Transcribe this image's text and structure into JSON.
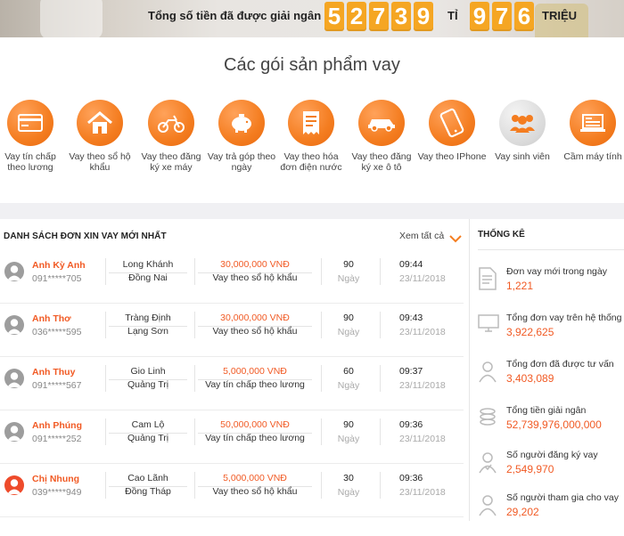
{
  "banner": {
    "label": "Tổng số tiền đã được giải ngân :",
    "billions_digits": [
      "5",
      "2",
      "7",
      "3",
      "9"
    ],
    "billion_unit": "TỈ",
    "millions_digits": [
      "9",
      "7",
      "6"
    ],
    "million_unit": "TRIỆU",
    "digit_color": "#f5a623"
  },
  "products": {
    "title": "Các gói sản phẩm vay",
    "items": [
      {
        "label": "Vay tín chấp theo lương",
        "icon": "credit-card-icon"
      },
      {
        "label": "Vay theo sổ hộ khẩu",
        "icon": "house-icon"
      },
      {
        "label": "Vay theo đăng ký xe máy",
        "icon": "motorbike-icon"
      },
      {
        "label": "Vay trả góp theo ngày",
        "icon": "piggy-bank-icon"
      },
      {
        "label": "Vay theo hóa đơn điện nước",
        "icon": "invoice-icon"
      },
      {
        "label": "Vay theo đăng ký xe ô tô",
        "icon": "car-icon"
      },
      {
        "label": "Vay theo IPhone",
        "icon": "phone-icon"
      },
      {
        "label": "Vay sinh viên",
        "icon": "students-icon"
      },
      {
        "label": "Cầm máy tính",
        "icon": "laptop-icon"
      }
    ]
  },
  "applications": {
    "title": "DANH SÁCH ĐƠN XIN VAY MỚI NHẤT",
    "see_all": "Xem tất cả",
    "day_label": "Ngày",
    "rows": [
      {
        "name": "Anh Kỳ Anh",
        "phone": "091*****705",
        "city": "Long Khánh",
        "province": "Đồng Nai",
        "amount": "30,000,000 VNĐ",
        "type": "Vay theo sổ hộ khẩu",
        "days": "90",
        "time": "09:44",
        "date": "23/11/2018",
        "avatar": "male"
      },
      {
        "name": "Anh Thơ",
        "phone": "036*****595",
        "city": "Tràng Định",
        "province": "Lạng Sơn",
        "amount": "30,000,000 VNĐ",
        "type": "Vay theo sổ hộ khẩu",
        "days": "90",
        "time": "09:43",
        "date": "23/11/2018",
        "avatar": "male"
      },
      {
        "name": "Anh Thuy",
        "phone": "091*****567",
        "city": "Gio Linh",
        "province": "Quảng Trị",
        "amount": "5,000,000 VNĐ",
        "type": "Vay tín chấp theo lương",
        "days": "60",
        "time": "09:37",
        "date": "23/11/2018",
        "avatar": "male"
      },
      {
        "name": "Anh Phúng",
        "phone": "091*****252",
        "city": "Cam Lộ",
        "province": "Quảng Trị",
        "amount": "50,000,000 VNĐ",
        "type": "Vay tín chấp theo lương",
        "days": "90",
        "time": "09:36",
        "date": "23/11/2018",
        "avatar": "male"
      },
      {
        "name": "Chị Nhung",
        "phone": "039*****949",
        "city": "Cao Lãnh",
        "province": "Đồng Tháp",
        "amount": "5,000,000 VNĐ",
        "type": "Vay theo sổ hộ khẩu",
        "days": "30",
        "time": "09:36",
        "date": "23/11/2018",
        "avatar": "female"
      }
    ]
  },
  "stats": {
    "title": "THỐNG KÊ",
    "items": [
      {
        "label": "Đơn vay mới trong ngày",
        "value": "1,221",
        "icon": "document-icon"
      },
      {
        "label": "Tổng đơn vay trên hệ thống",
        "value": "3,922,625",
        "icon": "monitor-icon"
      },
      {
        "label": "Tổng đơn đã được tư vấn",
        "value": "3,403,089",
        "icon": "consultant-icon"
      },
      {
        "label": "Tổng tiền giải ngân",
        "value": "52,739,976,000,000",
        "icon": "coins-icon"
      },
      {
        "label": "Số người đăng ký vay",
        "value": "2,549,970",
        "icon": "user-register-icon"
      },
      {
        "label": "Số người tham gia cho vay",
        "value": "29,202",
        "icon": "lender-icon"
      }
    ]
  },
  "colors": {
    "accent": "#f47d20",
    "highlight": "#f15a24"
  }
}
